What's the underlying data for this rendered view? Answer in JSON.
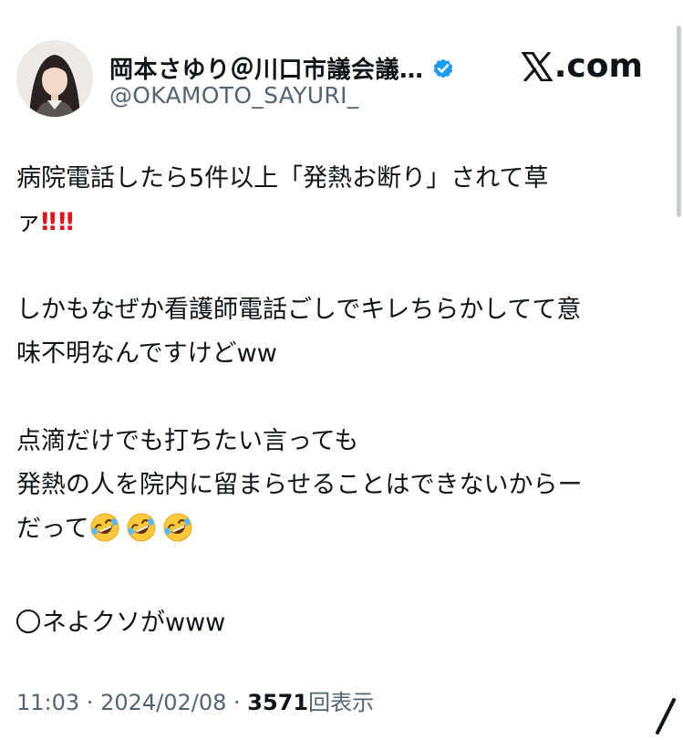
{
  "author": {
    "display_name": "岡本さゆり＠川口市議会議…",
    "handle": "@OKAMOTO_SAYURI_",
    "verified_icon": "verified-badge-icon",
    "avatar": "profile-photo"
  },
  "brand": {
    "label": ".com",
    "icon": "x-logo-icon"
  },
  "tweet": {
    "line1": "病院電話したら5件以上「発熱お断り」されて草",
    "line2_text": "ァ",
    "line2_bangs": [
      "‼",
      "‼"
    ],
    "line3": "しかもなぜか看護師電話ごしでキレちらかしてて意",
    "line4": "味不明なんですけどww",
    "line5": "点滴だけでも打ちたい言っても",
    "line6": "発熱の人を院内に留まらせることはできないからー",
    "line7_text": "だって",
    "line7_emoji": [
      "rolling-on-floor-laughing-emoji",
      "rolling-on-floor-laughing-emoji",
      "rolling-on-floor-laughing-emoji"
    ],
    "line8_text": "ネよクソがwww"
  },
  "meta": {
    "time": "11:03",
    "separator1": " · ",
    "date": "2024/02/08",
    "separator2": " · ",
    "views_count": "3571",
    "views_label": "回表示"
  },
  "colors": {
    "text": "#0f1419",
    "secondary": "#536471",
    "verified": "#1d9bf0",
    "bang": "#e0141e"
  }
}
